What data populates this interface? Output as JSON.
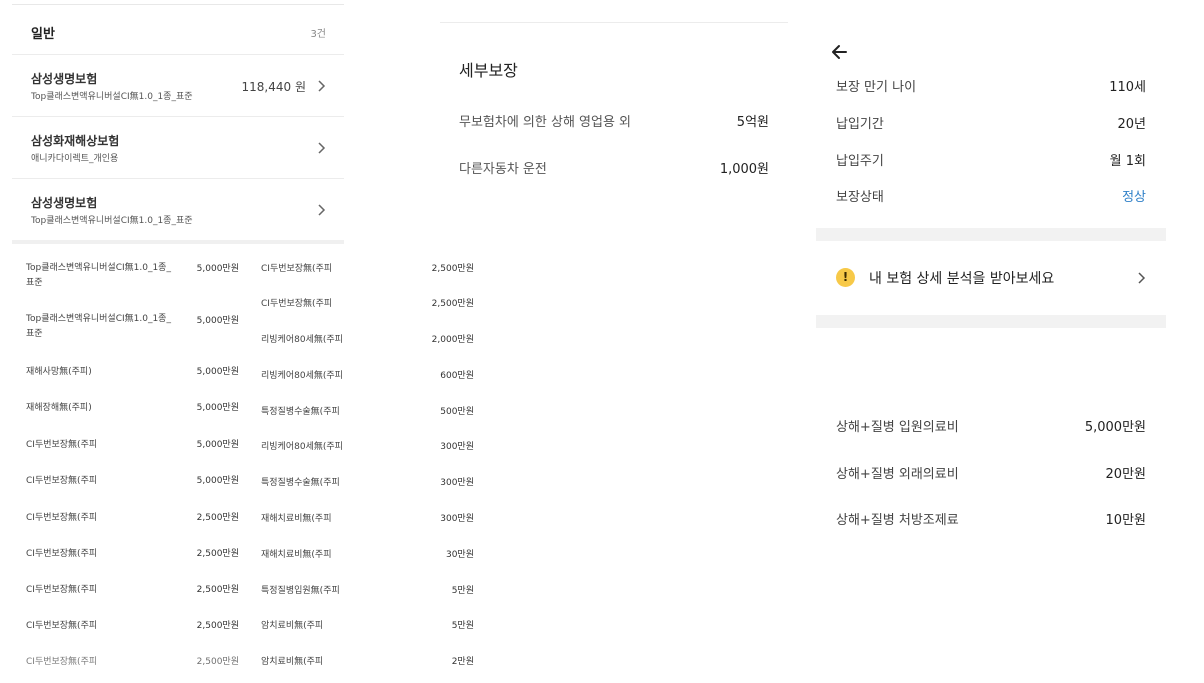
{
  "left": {
    "section_title": "일반",
    "section_count": "3건",
    "insurances": [
      {
        "name": "삼성생명보험",
        "sub": "Top클래스변액유니버설CI無1.0_1종_표준",
        "amount": "118,440 원"
      },
      {
        "name": "삼성화재해상보험",
        "sub": "애니카다이렉트_개인용",
        "amount": ""
      },
      {
        "name": "삼성생명보험",
        "sub": "Top클래스변액유니버설CI無1.0_1종_표준",
        "amount": ""
      }
    ],
    "coverages_col1": [
      {
        "name": "Top클래스변액유니버설CI無1.0_1종_",
        "name2": "표준",
        "amount": "5,000만원"
      },
      {
        "name": "Top클래스변액유니버설CI無1.0_1종_",
        "name2": "표준",
        "amount": "5,000만원"
      },
      {
        "name": "재해사망無(주피)",
        "name2": "",
        "amount": "5,000만원"
      },
      {
        "name": "재해장해無(주피)",
        "name2": "",
        "amount": "5,000만원"
      },
      {
        "name": "CI두번보장無(주피",
        "name2": "",
        "amount": "5,000만원"
      },
      {
        "name": "CI두번보장無(주피",
        "name2": "",
        "amount": "5,000만원"
      },
      {
        "name": "CI두번보장無(주피",
        "name2": "",
        "amount": "2,500만원"
      },
      {
        "name": "CI두번보장無(주피",
        "name2": "",
        "amount": "2,500만원"
      },
      {
        "name": "CI두번보장無(주피",
        "name2": "",
        "amount": "2,500만원"
      },
      {
        "name": "CI두번보장無(주피",
        "name2": "",
        "amount": "2,500만원"
      },
      {
        "name": "CI두번보장無(주피",
        "name2": "",
        "amount": "2,500만원"
      }
    ],
    "coverages_col2": [
      {
        "name": "CI두번보장無(주피",
        "amount": "2,500만원"
      },
      {
        "name": "CI두번보장無(주피",
        "amount": "2,500만원"
      },
      {
        "name": "리빙케어80세無(주피",
        "amount": "2,000만원"
      },
      {
        "name": "리빙케어80세無(주피",
        "amount": "600만원"
      },
      {
        "name": "특정질병수술無(주피",
        "amount": "500만원"
      },
      {
        "name": "리빙케어80세無(주피",
        "amount": "300만원"
      },
      {
        "name": "특정질병수술無(주피",
        "amount": "300만원"
      },
      {
        "name": "재해치료비無(주피",
        "amount": "300만원"
      },
      {
        "name": "재해치료비無(주피",
        "amount": "30만원"
      },
      {
        "name": "특정질병입원無(주피",
        "amount": "5만원"
      },
      {
        "name": "암치료비無(주피",
        "amount": "5만원"
      },
      {
        "name": "암치료비無(주피",
        "amount": "2만원"
      }
    ]
  },
  "middle": {
    "title": "세부보장",
    "rows": [
      {
        "label": "무보험차에 의한 상해 영업용 외",
        "value": "5억원"
      },
      {
        "label": "다른자동차 운전",
        "value": "1,000원"
      }
    ]
  },
  "right": {
    "details": [
      {
        "label": "보장 만기 나이",
        "value": "110세"
      },
      {
        "label": "납입기간",
        "value": "20년"
      },
      {
        "label": "납입주기",
        "value": "월 1회"
      },
      {
        "label": "보장상태",
        "value": "정상"
      }
    ],
    "status_color": "#2f80c8",
    "analysis_icon": "!",
    "analysis_text": "내 보험 상세 분석을 받아보세요",
    "medical": [
      {
        "label": "상해+질병 입원의료비",
        "value": "5,000만원"
      },
      {
        "label": "상해+질병 외래의료비",
        "value": "20만원"
      },
      {
        "label": "상해+질병 처방조제료",
        "value": "10만원"
      }
    ]
  }
}
